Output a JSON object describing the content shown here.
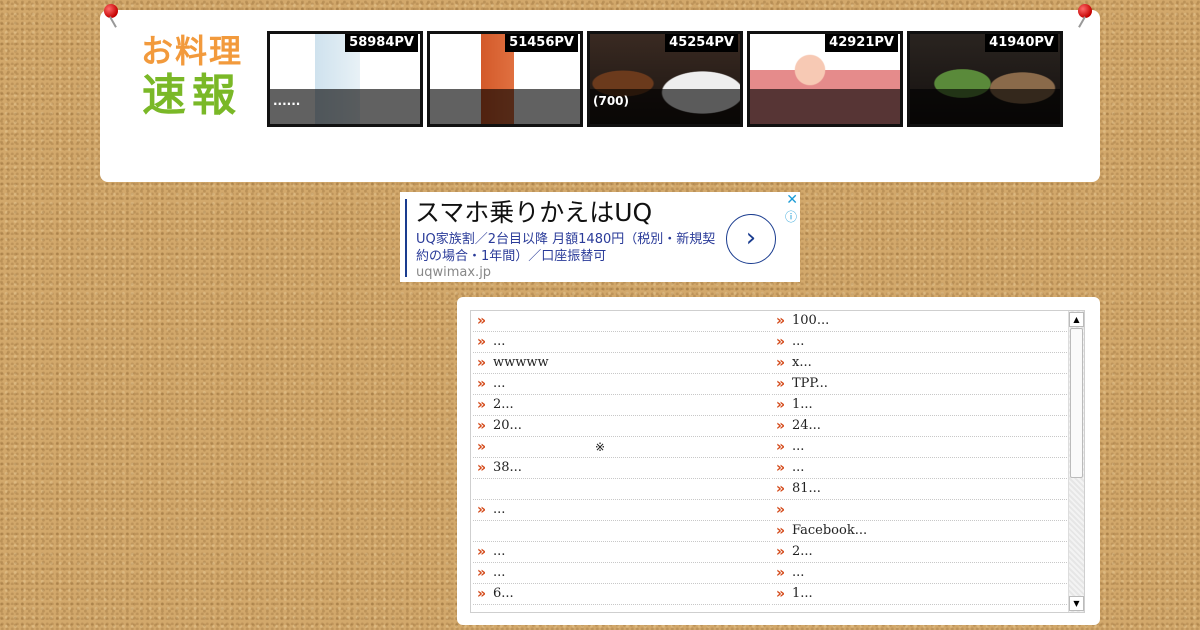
{
  "logo": {
    "line1": "お料理",
    "line2": "速報"
  },
  "thumbnails": [
    {
      "pv": "58984PV",
      "caption": "......"
    },
    {
      "pv": "51456PV",
      "caption": ""
    },
    {
      "pv": "45254PV",
      "caption": "(700)"
    },
    {
      "pv": "42921PV",
      "caption": ""
    },
    {
      "pv": "41940PV",
      "caption": ""
    }
  ],
  "ad": {
    "title": "スマホ乗りかえはUQ",
    "body": "UQ家族割／2台目以降 月額1480円（税別・新規契約の場合・1年間）／口座振替可",
    "url": "uqwimax.jp",
    "arrow": "›",
    "close": "✕",
    "info": "ⓘ"
  },
  "list": {
    "arrow_glyph": "»",
    "left": [
      {
        "text": "",
        "note": ""
      },
      {
        "text": "...",
        "note": ""
      },
      {
        "text": "wwwww",
        "note": ""
      },
      {
        "text": "...",
        "note": ""
      },
      {
        "text": "2...",
        "note": ""
      },
      {
        "text": "20...",
        "note": ""
      },
      {
        "text": "",
        "note": "※"
      },
      {
        "text": "38...",
        "note": ""
      },
      {
        "text": "",
        "note": "",
        "blank": true
      },
      {
        "text": "...",
        "note": ""
      },
      {
        "text": "",
        "note": "",
        "blank": true
      },
      {
        "text": "...",
        "note": ""
      },
      {
        "text": "...",
        "note": ""
      },
      {
        "text": "6...",
        "note": ""
      }
    ],
    "right": [
      {
        "text": "100..."
      },
      {
        "text": "..."
      },
      {
        "text": "x..."
      },
      {
        "text": "TPP..."
      },
      {
        "text": "1..."
      },
      {
        "text": "24..."
      },
      {
        "text": "..."
      },
      {
        "text": "..."
      },
      {
        "text": "81..."
      },
      {
        "text": ""
      },
      {
        "text": "Facebook..."
      },
      {
        "text": "2..."
      },
      {
        "text": "..."
      },
      {
        "text": "1..."
      }
    ]
  },
  "scrollbar": {
    "up": "▲",
    "down": "▼"
  }
}
